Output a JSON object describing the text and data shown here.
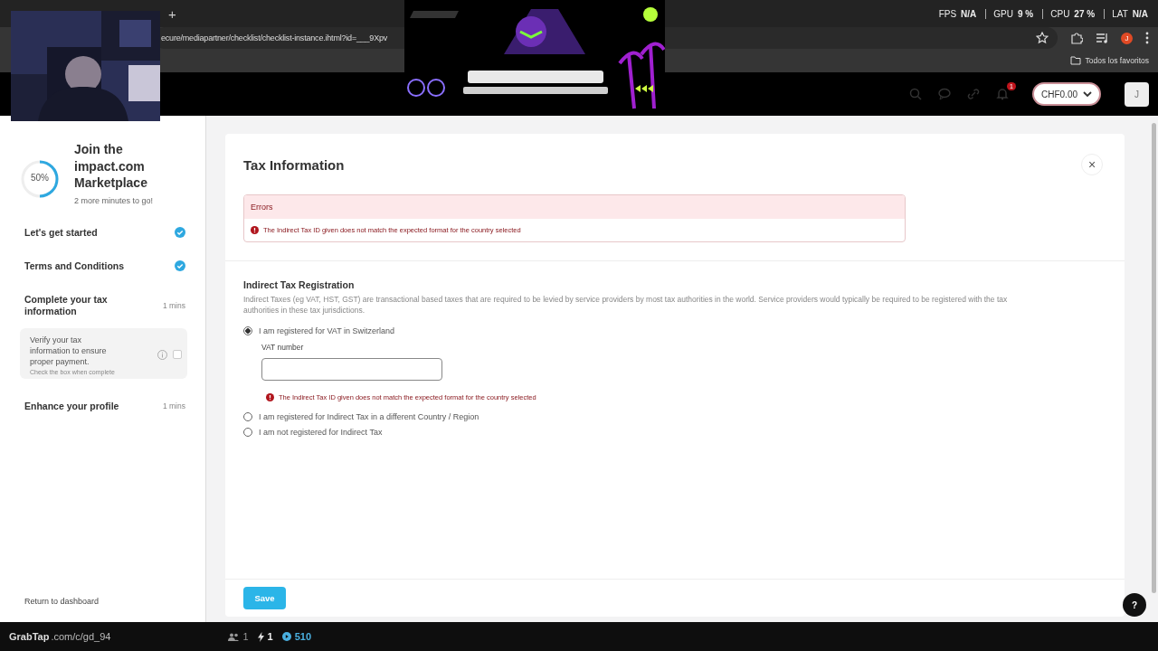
{
  "browser": {
    "new_tab": "+",
    "address": "ecure/mediapartner/checklist/checklist-instance.ihtml?id=___9Xpv",
    "bookmarks": "Todos los favoritos",
    "profile": "J"
  },
  "overlay_stats": [
    {
      "label": "FPS",
      "value": "N/A"
    },
    {
      "label": "GPU",
      "value": "9 %"
    },
    {
      "label": "CPU",
      "value": "27 %"
    },
    {
      "label": "LAT",
      "value": "N/A"
    }
  ],
  "header": {
    "notification_count": "1",
    "balance": "CHF0.00",
    "avatar": "J"
  },
  "sidebar": {
    "progress": {
      "level": 0.5,
      "label": "50%"
    },
    "title": "Join the impact.com Marketplace",
    "subtitle": "2 more minutes to go!",
    "steps": [
      {
        "label": "Let's get started",
        "done": true
      },
      {
        "label": "Terms and Conditions",
        "done": true
      },
      {
        "label": "Complete your tax information",
        "done": false,
        "duration": "1 mins",
        "tasks": [
          {
            "label": "Verify your tax information to ensure proper payment.",
            "hint": "Check the box when complete",
            "checked": false
          }
        ]
      },
      {
        "label": "Enhance your profile",
        "done": false,
        "duration": "1 mins"
      }
    ],
    "return_link": "Return to dashboard"
  },
  "form": {
    "title": "Tax Information",
    "close": "×",
    "errors": {
      "title": "Errors",
      "messages": [
        "The Indirect Tax ID given does not match the expected format for the country selected"
      ]
    },
    "section_title": "Indirect Tax Registration",
    "description": "Indirect Taxes (eg VAT, HST, GST) are transactional based taxes that are required to be levied by service providers by most tax authorities in the world. Service providers would typically be required to be registered with the tax authorities in these tax jurisdictions.",
    "options": [
      {
        "label": "I am registered for VAT in Switzerland",
        "selected": true,
        "field": {
          "label": "VAT number",
          "error": "The Indirect Tax ID given does not match the expected format for the country selected"
        }
      },
      {
        "label": "I am registered for Indirect Tax in a different Country / Region",
        "selected": false
      },
      {
        "label": "I am not registered for Indirect Tax",
        "selected": false
      }
    ],
    "save": "Save"
  },
  "help": "?",
  "stream_bar": {
    "brand": "GrabTap",
    "url": ".com/c/gd_94",
    "viewers": "1",
    "boosts": "1",
    "points": "510"
  }
}
